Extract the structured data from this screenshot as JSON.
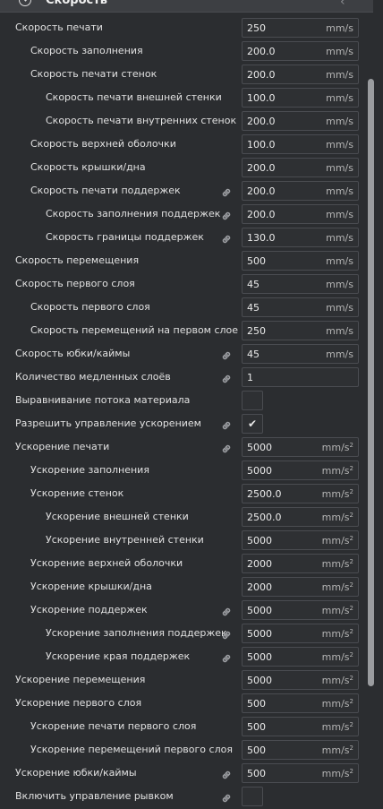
{
  "header": {
    "title": "Скорость",
    "icon": "speedometer-icon"
  },
  "rows": [
    {
      "label": "Скорость печати",
      "indent": 0,
      "value": "250",
      "unit": "mm/s"
    },
    {
      "label": "Скорость заполнения",
      "indent": 1,
      "value": "200.0",
      "unit": "mm/s"
    },
    {
      "label": "Скорость печати стенок",
      "indent": 1,
      "value": "200.0",
      "unit": "mm/s"
    },
    {
      "label": "Скорость печати внешней стенки",
      "indent": 2,
      "value": "100.0",
      "unit": "mm/s"
    },
    {
      "label": "Скорость печати внутренних стенок",
      "indent": 2,
      "value": "200.0",
      "unit": "mm/s"
    },
    {
      "label": "Скорость верхней оболочки",
      "indent": 1,
      "value": "100.0",
      "unit": "mm/s"
    },
    {
      "label": "Скорость крышки/дна",
      "indent": 1,
      "value": "200.0",
      "unit": "mm/s"
    },
    {
      "label": "Скорость печати поддержек",
      "indent": 1,
      "value": "200.0",
      "unit": "mm/s",
      "link": true
    },
    {
      "label": "Скорость заполнения поддержек",
      "indent": 2,
      "value": "200.0",
      "unit": "mm/s",
      "link": true
    },
    {
      "label": "Скорость границы поддержек",
      "indent": 2,
      "value": "130.0",
      "unit": "mm/s",
      "link": true
    },
    {
      "label": "Скорость перемещения",
      "indent": 0,
      "value": "500",
      "unit": "mm/s"
    },
    {
      "label": "Скорость первого слоя",
      "indent": 0,
      "value": "45",
      "unit": "mm/s"
    },
    {
      "label": "Скорость первого слоя",
      "indent": 1,
      "value": "45",
      "unit": "mm/s"
    },
    {
      "label": "Скорость перемещений на первом слое",
      "indent": 1,
      "value": "250",
      "unit": "mm/s"
    },
    {
      "label": "Скорость юбки/каймы",
      "indent": 0,
      "value": "45",
      "unit": "mm/s",
      "link": true
    },
    {
      "label": "Количество медленных слоёв",
      "indent": 0,
      "value": "1",
      "unit": "",
      "link": true
    },
    {
      "label": "Выравнивание потока материала",
      "indent": 0,
      "type": "checkbox",
      "checked": false
    },
    {
      "label": "Разрешить управление ускорением",
      "indent": 0,
      "type": "checkbox",
      "checked": true,
      "link": true
    },
    {
      "label": "Ускорение печати",
      "indent": 0,
      "value": "5000",
      "unit": "mm/s",
      "sup": "2",
      "link": true
    },
    {
      "label": "Ускорение заполнения",
      "indent": 1,
      "value": "5000",
      "unit": "mm/s",
      "sup": "2"
    },
    {
      "label": "Ускорение стенок",
      "indent": 1,
      "value": "2500.0",
      "unit": "mm/s",
      "sup": "2"
    },
    {
      "label": "Ускорение внешней стенки",
      "indent": 2,
      "value": "2500.0",
      "unit": "mm/s",
      "sup": "2"
    },
    {
      "label": "Ускорение внутренней стенки",
      "indent": 2,
      "value": "5000",
      "unit": "mm/s",
      "sup": "2"
    },
    {
      "label": "Ускорение верхней оболочки",
      "indent": 1,
      "value": "2000",
      "unit": "mm/s",
      "sup": "2"
    },
    {
      "label": "Ускорение крышки/дна",
      "indent": 1,
      "value": "2000",
      "unit": "mm/s",
      "sup": "2"
    },
    {
      "label": "Ускорение поддержек",
      "indent": 1,
      "value": "5000",
      "unit": "mm/s",
      "sup": "2",
      "link": true
    },
    {
      "label": "Ускорение заполнения поддержек",
      "indent": 2,
      "value": "5000",
      "unit": "mm/s",
      "sup": "2",
      "link": true
    },
    {
      "label": "Ускорение края поддержек",
      "indent": 2,
      "value": "5000",
      "unit": "mm/s",
      "sup": "2",
      "link": true
    },
    {
      "label": "Ускорение перемещения",
      "indent": 0,
      "value": "5000",
      "unit": "mm/s",
      "sup": "2"
    },
    {
      "label": "Ускорение первого слоя",
      "indent": 0,
      "value": "500",
      "unit": "mm/s",
      "sup": "2"
    },
    {
      "label": "Ускорение печати первого слоя",
      "indent": 1,
      "value": "500",
      "unit": "mm/s",
      "sup": "2"
    },
    {
      "label": "Ускорение перемещений первого слоя",
      "indent": 1,
      "value": "500",
      "unit": "mm/s",
      "sup": "2"
    },
    {
      "label": "Ускорение юбки/каймы",
      "indent": 0,
      "value": "500",
      "unit": "mm/s",
      "sup": "2",
      "link": true
    },
    {
      "label": "Включить управление рывком",
      "indent": 0,
      "type": "checkbox",
      "checked": false,
      "link": true
    }
  ]
}
